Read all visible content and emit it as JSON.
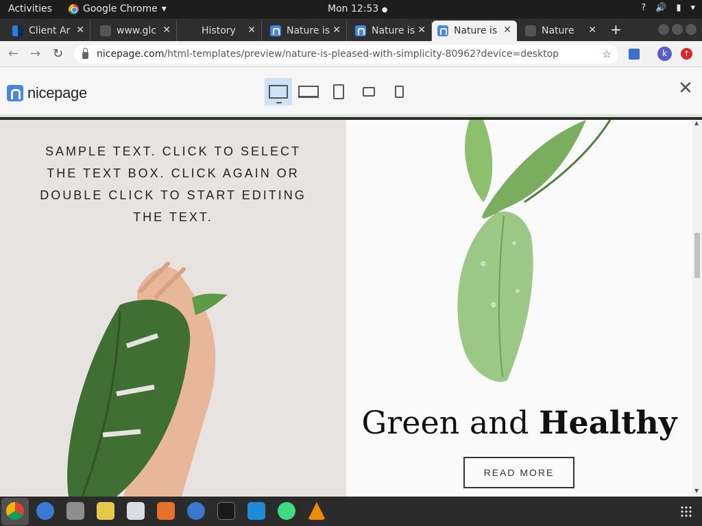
{
  "topbar": {
    "activities": "Activities",
    "app_name": "Google Chrome",
    "app_arrow": "▾",
    "clock": "Mon 12:53",
    "tray": {
      "help": "?",
      "volume": "🔊",
      "battery": "▮",
      "menu": "▾"
    }
  },
  "tabs": [
    {
      "title": "Client Ar",
      "favicon": "client-icon"
    },
    {
      "title": "www.glc",
      "favicon": "globe-icon"
    },
    {
      "title": "History",
      "favicon": "history-icon"
    },
    {
      "title": "Nature is",
      "favicon": "nicepage-icon"
    },
    {
      "title": "Nature is",
      "favicon": "nicepage-icon"
    },
    {
      "title": "Nature is",
      "favicon": "nicepage-icon",
      "active": true
    },
    {
      "title": "Nature",
      "favicon": "globe-icon"
    }
  ],
  "tab_close": "✕",
  "new_tab": "+",
  "toolbar": {
    "back": "←",
    "forward": "→",
    "reload": "↻",
    "url_host": "nicepage.com",
    "url_path": "/html-templates/preview/nature-is-pleased-with-simplicity-80962?device=desktop",
    "star": "☆",
    "avatar_letter": "k",
    "upload_badge": "↑"
  },
  "np_header": {
    "logo_text": "nicepage",
    "devices": [
      "desktop",
      "laptop",
      "tablet",
      "tablet-landscape",
      "phone"
    ],
    "active_device": "desktop",
    "close": "✕"
  },
  "left_panel": {
    "sample_text": "SAMPLE TEXT. CLICK TO SELECT THE TEXT BOX. CLICK AGAIN OR DOUBLE CLICK TO START EDITING THE TEXT."
  },
  "right_panel": {
    "headline_regular": "Green and ",
    "headline_bold": "Healthy",
    "button_label": "READ MORE"
  },
  "scrollbar": {
    "up": "▲",
    "down": "▼"
  },
  "dock": {
    "apps": [
      "chrome-icon",
      "thunderbird-icon",
      "files-icon",
      "rhythmbox-icon",
      "document-viewer-icon",
      "software-center-icon",
      "help-icon",
      "terminal-icon",
      "vscode-icon",
      "android-studio-icon",
      "vlc-icon"
    ]
  },
  "colors": {
    "accent": "#4786e4",
    "leaf_green": "#3f6f33",
    "hand": "#e8b79a"
  }
}
